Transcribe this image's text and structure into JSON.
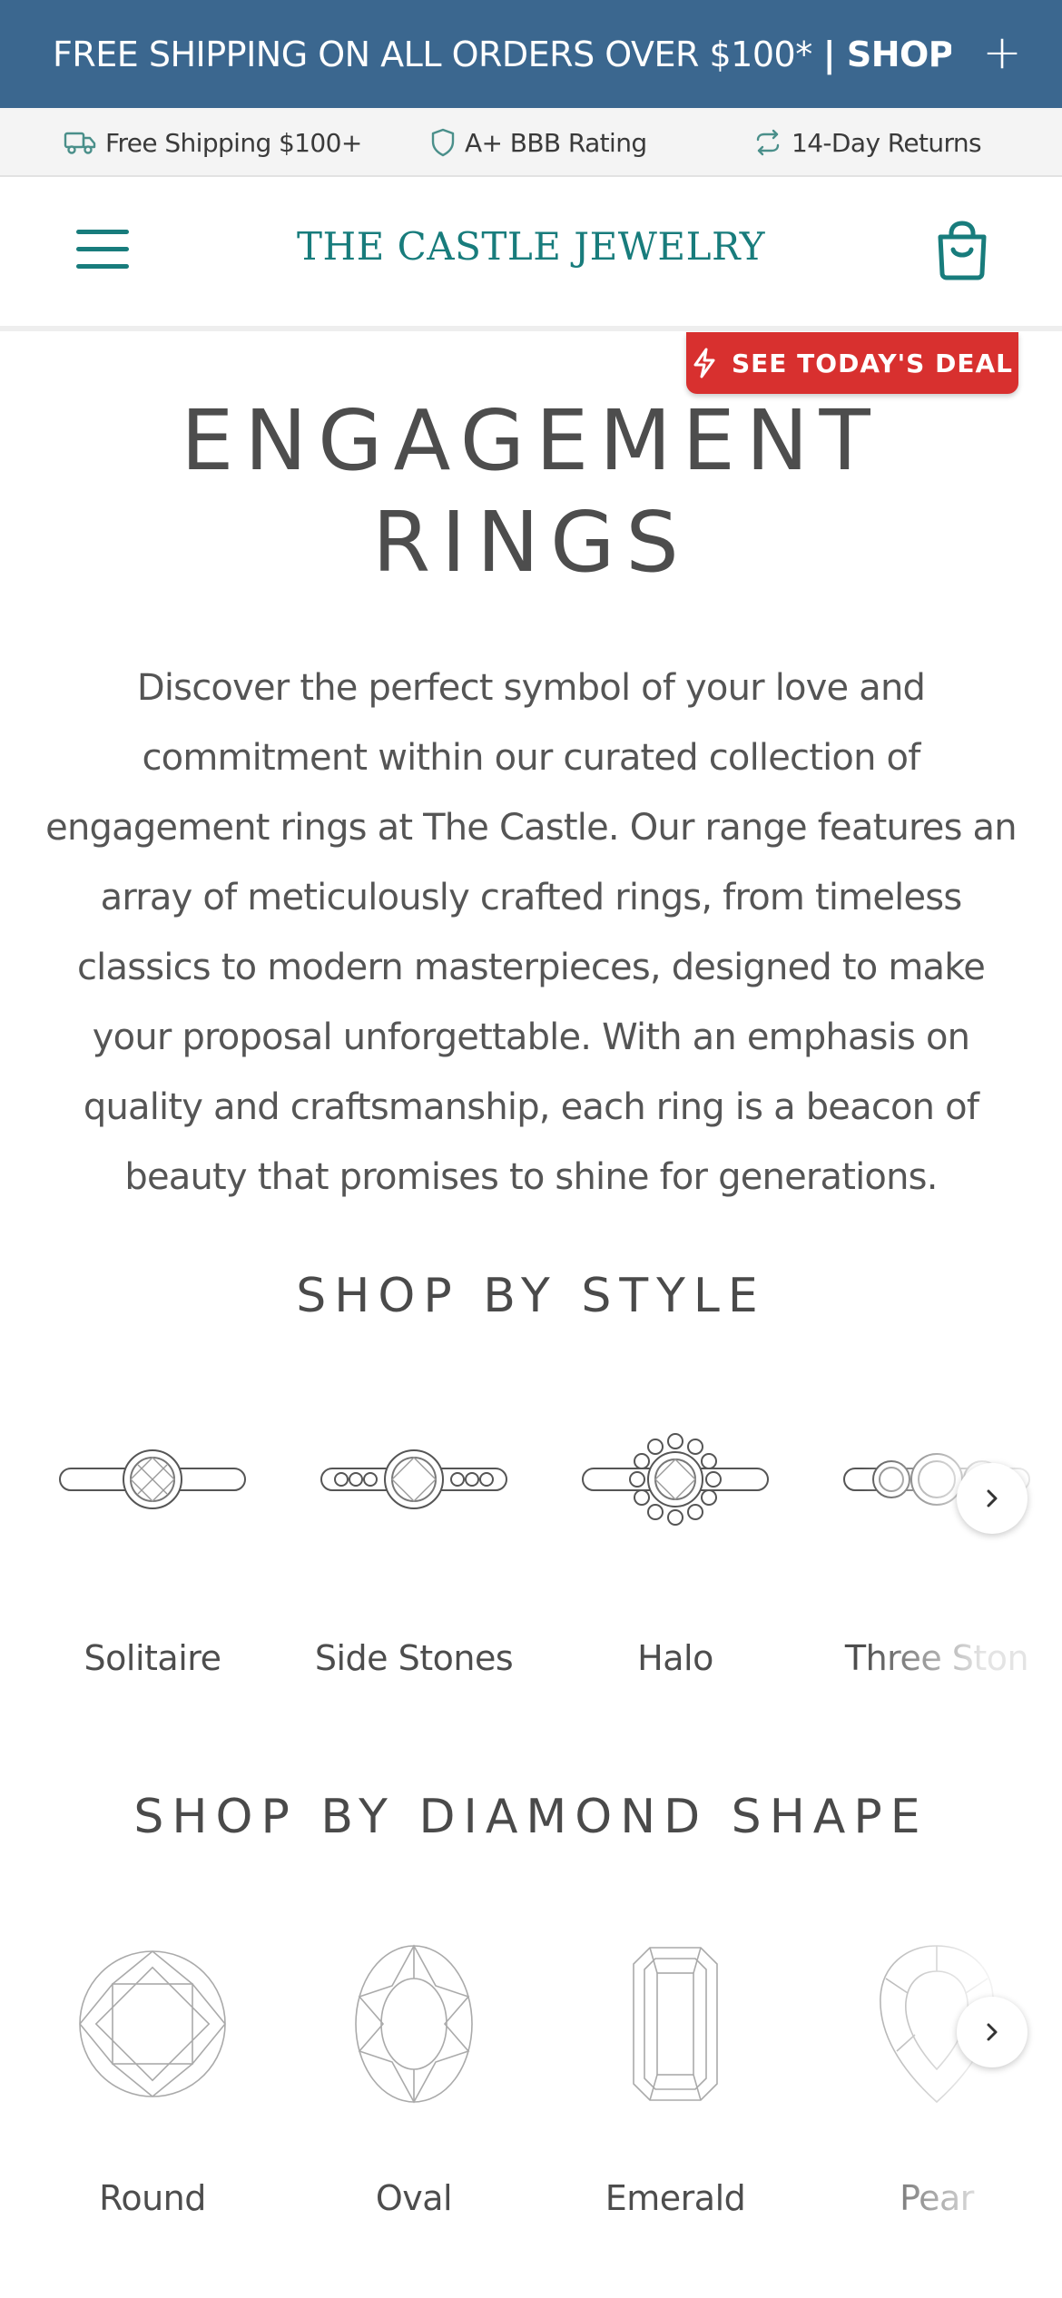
{
  "announcement": {
    "text": "FREE SHIPPING ON ALL ORDERS OVER $100*",
    "cta": "| SHOP NE…",
    "expand_icon": "plus-icon"
  },
  "trust_bar": [
    {
      "icon": "truck-icon",
      "label": "Free Shipping $100+"
    },
    {
      "icon": "shield-icon",
      "label": "A+ BBB Rating"
    },
    {
      "icon": "refresh-icon",
      "label": "14-Day Returns"
    }
  ],
  "header": {
    "menu_icon": "hamburger-menu-icon",
    "brand": "THE CASTLE JEWELRY",
    "cart_icon": "shopping-bag-icon",
    "accent_color": "#187c7c"
  },
  "deal_button": {
    "label": "SEE TODAY'S DEAL",
    "icon": "lightning-icon",
    "color": "#d8302f"
  },
  "page": {
    "title_line1": "ENGAGEMENT",
    "title_line2": "RINGS",
    "description": "Discover the perfect symbol of your love and commitment within our curated collection of engagement rings at The Castle. Our range features an array of meticulously crafted rings, from timeless classics to modern masterpieces, designed to make your proposal unforgettable. With an emphasis on quality and craftsmanship, each ring is a beacon of beauty that promises to shine for generations."
  },
  "shop_by_style": {
    "title": "SHOP BY STYLE",
    "items": [
      {
        "label": "Solitaire",
        "icon": "solitaire-ring-icon"
      },
      {
        "label": "Side Stones",
        "icon": "side-stones-ring-icon"
      },
      {
        "label": "Halo",
        "icon": "halo-ring-icon"
      },
      {
        "label": "Three Ston",
        "icon": "three-stone-ring-icon"
      }
    ],
    "next_icon": "chevron-right-icon"
  },
  "shop_by_shape": {
    "title": "SHOP BY DIAMOND SHAPE",
    "items": [
      {
        "label": "Round",
        "icon": "round-diamond-icon"
      },
      {
        "label": "Oval",
        "icon": "oval-diamond-icon"
      },
      {
        "label": "Emerald",
        "icon": "emerald-diamond-icon"
      },
      {
        "label": "Pear",
        "icon": "pear-diamond-icon"
      }
    ],
    "next_icon": "chevron-right-icon"
  }
}
